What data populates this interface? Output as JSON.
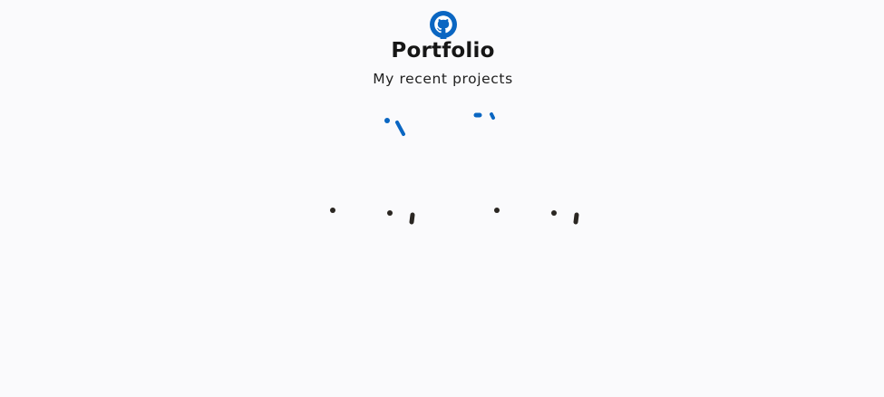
{
  "header": {
    "logo_icon": "github-icon",
    "title": "Portfolio",
    "subtitle": "My recent projects"
  },
  "colors": {
    "background": "#fafafc",
    "accent": "#0a66c2",
    "text": "#161616",
    "fragment_dark": "#2a2622"
  },
  "projects": {
    "cards": [
      {
        "name": "project-card-1"
      },
      {
        "name": "project-card-2"
      }
    ]
  }
}
